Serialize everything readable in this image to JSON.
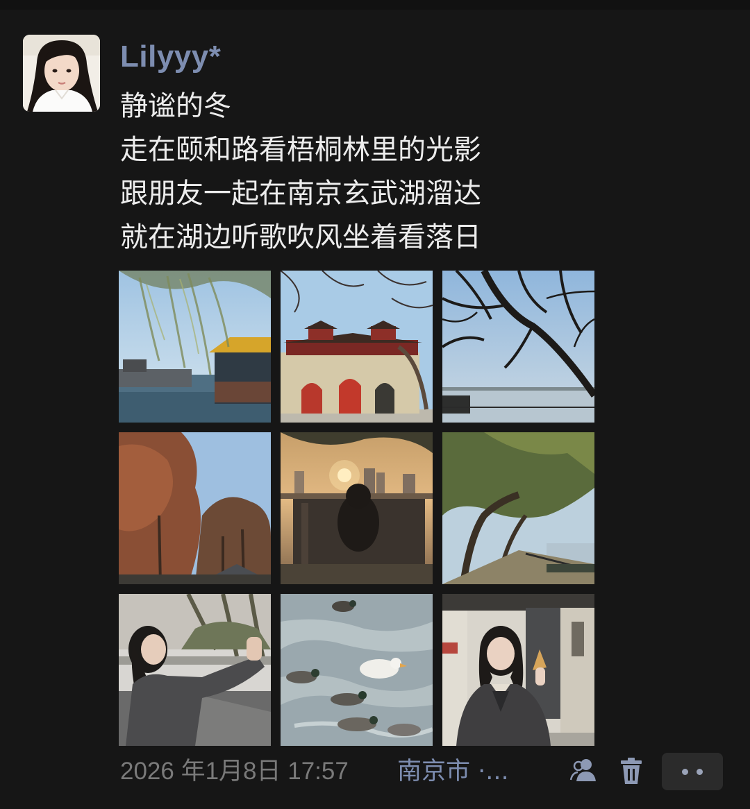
{
  "post": {
    "username": "Lilyyy*",
    "lines": [
      "静谧的冬",
      "走在颐和路看梧桐林里的光影",
      "跟朋友一起在南京玄武湖溜达",
      "就在湖边听歌吹风坐着看落日"
    ],
    "timestamp": "2026 年1月8日 17:57",
    "location": "南京市 ·..."
  },
  "photos": [
    {
      "scene": "lake-pavilion-willow"
    },
    {
      "scene": "city-gate-tower"
    },
    {
      "scene": "bare-tree-silhouette-lake"
    },
    {
      "scene": "autumn-trees-sky"
    },
    {
      "scene": "sunset-city-skyline"
    },
    {
      "scene": "lakeside-tree-path"
    },
    {
      "scene": "girl-street-portrait"
    },
    {
      "scene": "ducks-on-water"
    },
    {
      "scene": "girl-white-wall-portrait"
    }
  ],
  "icons": {
    "avatar": "avatar-photo",
    "visibility": "friends-icon",
    "delete": "trash-icon",
    "more": "more-dots-icon"
  },
  "colors": {
    "background": "#161616",
    "username": "#7d8db0",
    "body_text": "#ededed",
    "meta_text": "#7a7a7a",
    "link": "#7d8db0"
  }
}
